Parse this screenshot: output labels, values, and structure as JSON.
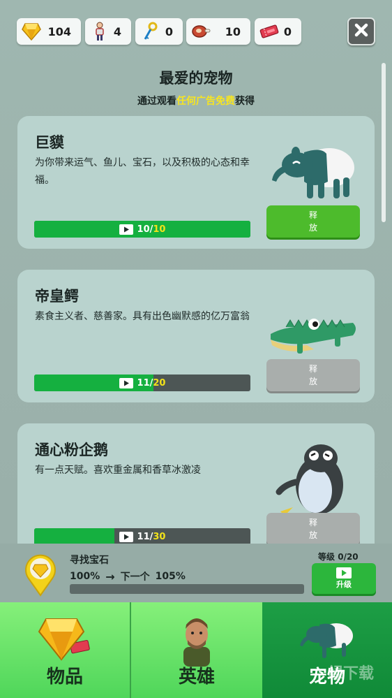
{
  "resources": [
    {
      "icon": "gem-icon",
      "value": "104"
    },
    {
      "icon": "hero-count-icon",
      "value": "4"
    },
    {
      "icon": "key-icon",
      "value": "0"
    },
    {
      "icon": "meat-icon",
      "value": "10"
    },
    {
      "icon": "ticket-icon",
      "value": "0"
    }
  ],
  "heading": {
    "title": "最爱的宠物",
    "sub_prefix": "通过观看",
    "sub_highlight": "任何广告免费",
    "sub_suffix": "获得"
  },
  "pets": [
    {
      "name": "巨貘",
      "desc": "为你带来运气、鱼儿、宝石，以及积极的心态和幸福。",
      "progress_current": "10",
      "progress_sep": "/",
      "progress_total": "10",
      "progress_fraction": 1.0,
      "release_label_1": "释",
      "release_label_2": "放",
      "release_enabled": true
    },
    {
      "name": "帝皇鳄",
      "desc": "素食主义者、慈善家。具有出色幽默感的亿万富翁",
      "progress_current": "11",
      "progress_sep": "/",
      "progress_total": "20",
      "progress_fraction": 0.55,
      "release_label_1": "释",
      "release_label_2": "放",
      "release_enabled": false
    },
    {
      "name": "通心粉企鹅",
      "desc": "有一点天赋。喜欢重金属和香草冰激凌",
      "progress_current": "11",
      "progress_sep": "/",
      "progress_total": "30",
      "progress_fraction": 0.37,
      "release_label_1": "释",
      "release_label_2": "放",
      "release_enabled": false
    }
  ],
  "upgrade": {
    "title": "寻找宝石",
    "current": "100%",
    "arrow": "→",
    "next_label": "下一个",
    "next_value": "105%",
    "level_label": "等级",
    "level_current": "0",
    "level_total": "/20",
    "button_label": "升级",
    "progress_fraction": 0
  },
  "tabs": [
    {
      "label": "物品"
    },
    {
      "label": "英雄"
    },
    {
      "label": "宠物"
    }
  ],
  "watermark": "绿下载",
  "colors": {
    "background": "#9fb7b0",
    "card": "#b9d3ce",
    "highlight_text": "#f7e520",
    "progress_green": "#15b040",
    "release_active": "#4dbb2c",
    "release_inactive": "#a9aeac",
    "tab_active": "#1d9e45",
    "tab_inactive": "#86f07a"
  }
}
